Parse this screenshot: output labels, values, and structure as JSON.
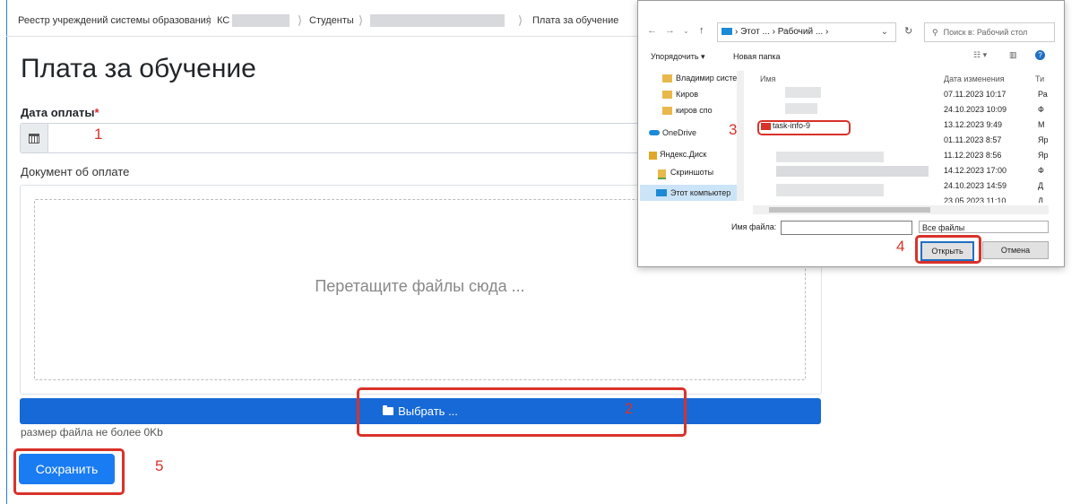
{
  "breadcrumb": [
    {
      "label": "Реестр учреждений системы образования"
    },
    {
      "label": "КС"
    },
    {
      "label": "Студенты"
    },
    {
      "label": "Плата за обучение"
    }
  ],
  "page_title": "Плата за обучение",
  "form": {
    "date_label": "Дата оплаты",
    "required_mark": "*",
    "date_value": "",
    "document_label": "Документ об оплате",
    "drop_text": "Перетащите файлы сюда ...",
    "pick_button": "Выбрать ...",
    "size_note": "размер файла не более 0Kb",
    "save_button": "Сохранить"
  },
  "annotations": [
    "1",
    "2",
    "3",
    "4",
    "5"
  ],
  "dialog": {
    "path_segments": [
      "Этот ...",
      "Рабочий ..."
    ],
    "search_placeholder": "Поиск в: Рабочий стол",
    "toolbar": {
      "organize": "Упорядочить ▾",
      "new_folder": "Новая папка"
    },
    "sidebar": [
      {
        "label": "Владимир систе"
      },
      {
        "label": "Киров"
      },
      {
        "label": "киров спо"
      },
      {
        "label": "OneDrive"
      },
      {
        "label": "Яндекс.Диск"
      },
      {
        "label": "Скриншоты"
      },
      {
        "label": "Этот компьютер"
      }
    ],
    "columns": {
      "name": "Имя",
      "date": "Дата изменения",
      "type": "Ти"
    },
    "files": [
      {
        "name": "",
        "date": "07.11.2023 10:17",
        "type": "Ра"
      },
      {
        "name": "",
        "date": "24.10.2023 10:09",
        "type": "Ф"
      },
      {
        "name": "task-info-9",
        "date": "13.12.2023 9:49",
        "type": "М"
      },
      {
        "name": "",
        "date": "01.11.2023 8:57",
        "type": "Яр"
      },
      {
        "name": "",
        "date": "11.12.2023 8:56",
        "type": "Яр"
      },
      {
        "name": "",
        "date": "14.12.2023 17:00",
        "type": "Ф"
      },
      {
        "name": "",
        "date": "24.10.2023 14:59",
        "type": "Д"
      },
      {
        "name": "",
        "date": "23.05.2023 11:10",
        "type": "Д"
      }
    ],
    "filename_label": "Имя файла:",
    "filename_value": "",
    "filetype_value": "Все файлы",
    "open_button": "Открыть",
    "cancel_button": "Отмена"
  }
}
